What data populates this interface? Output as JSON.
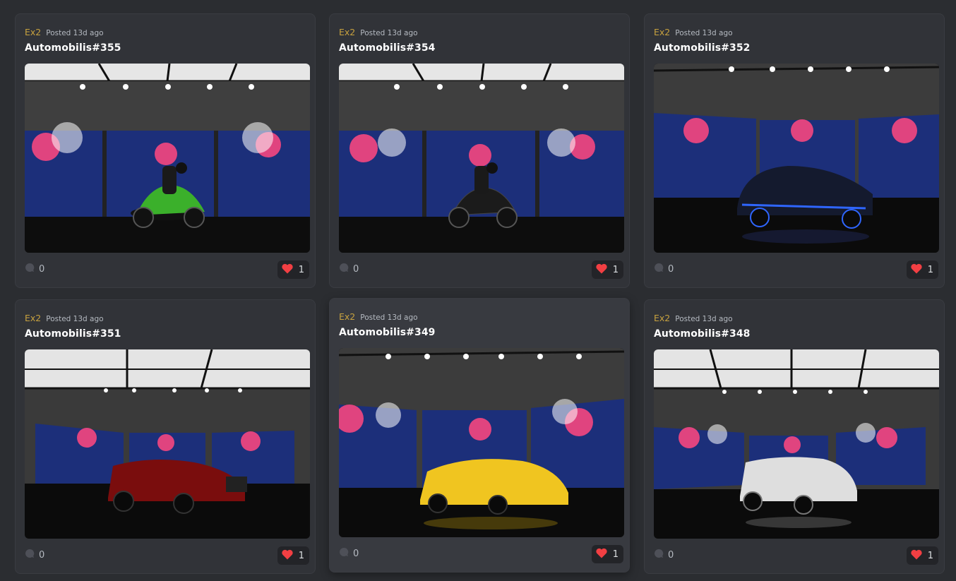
{
  "posts": [
    {
      "author": "Ex2",
      "posted": "Posted 13d ago",
      "title": "Automobilis#355",
      "comments": "0",
      "likes": "1",
      "vehicle": "green-motorcycle"
    },
    {
      "author": "Ex2",
      "posted": "Posted 13d ago",
      "title": "Automobilis#354",
      "comments": "0",
      "likes": "1",
      "vehicle": "black-motorcycle"
    },
    {
      "author": "Ex2",
      "posted": "Posted 13d ago",
      "title": "Automobilis#352",
      "comments": "0",
      "likes": "1",
      "vehicle": "black-blue-sports-car"
    },
    {
      "author": "Ex2",
      "posted": "Posted 13d ago",
      "title": "Automobilis#351",
      "comments": "0",
      "likes": "1",
      "vehicle": "red-suv"
    },
    {
      "author": "Ex2",
      "posted": "Posted 13d ago",
      "title": "Automobilis#349",
      "comments": "0",
      "likes": "1",
      "vehicle": "yellow-supercar"
    },
    {
      "author": "Ex2",
      "posted": "Posted 13d ago",
      "title": "Automobilis#348",
      "comments": "0",
      "likes": "1",
      "vehicle": "white-suv"
    }
  ],
  "colors": {
    "background": "#2b2d31",
    "card": "#313338",
    "author": "#c7a13f",
    "heart": "#f23f43"
  },
  "icons": {
    "comment": "comment-bubble-icon",
    "like": "heart-icon"
  }
}
